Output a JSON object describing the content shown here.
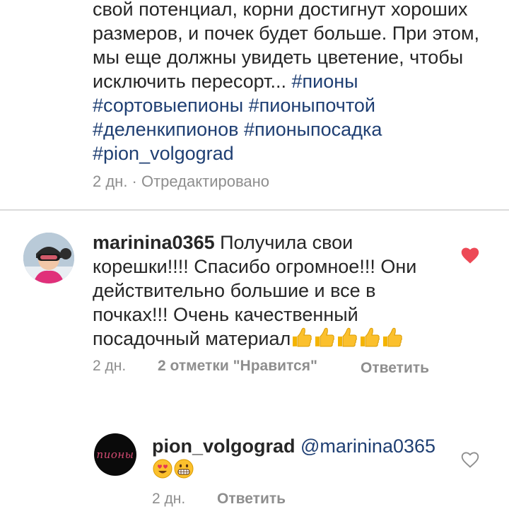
{
  "caption": {
    "text": "свой потенциал, корни достигнут хороших размеров, и почек будет больше. При этом, мы еще должны увидеть цветение, чтобы исключить пересорт...",
    "hashtags": [
      "#пионы",
      "#сортовыепионы",
      "#пионыпочтой",
      "#деленкипионов",
      "#пионыпосадка",
      "#pion_volgograd"
    ],
    "meta": "2 дн. · Отредактировано"
  },
  "comments": [
    {
      "username": "marinina0365",
      "text": "Получила свои корешки!!!! Спасибо огромное!!! Они действительно большие и все в почках!!! Очень качественный посадочный материал",
      "emoji_count": 5,
      "date": "2 дн.",
      "likes": "2 отметки \"Нравится\"",
      "reply": "Ответить",
      "liked": true,
      "like_color": "#ed4956"
    },
    {
      "username": "pion_volgograd",
      "mention": "@marinina0365",
      "avatar_text": "пионы",
      "date": "2 дн.",
      "reply": "Ответить",
      "liked": false
    }
  ],
  "icons": {
    "like": "heart-icon",
    "thumbs": "thumbs-up-emoji",
    "heart_eyes": "heart-eyes-emoji",
    "grin": "grinning-emoji"
  },
  "colors": {
    "link": "#1f3f73",
    "meta": "#8e8e8e"
  }
}
